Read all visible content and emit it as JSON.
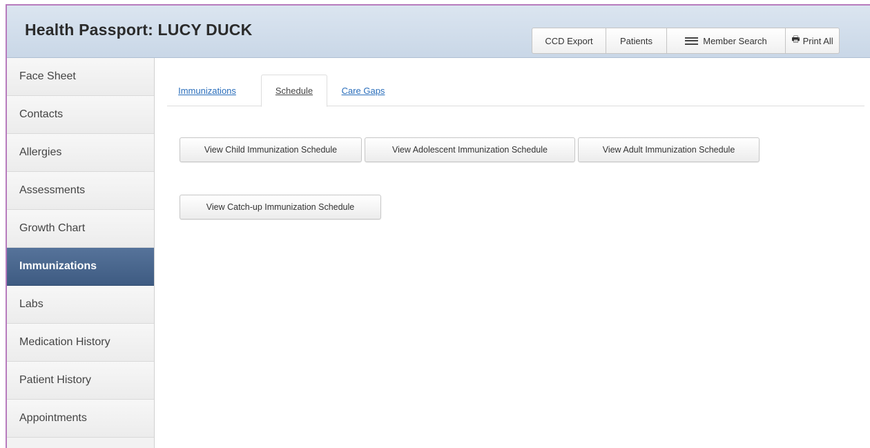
{
  "header": {
    "title": "Health Passport: LUCY DUCK",
    "buttons": {
      "ccd_export": "CCD Export",
      "patients": "Patients",
      "member_search": "Member Search",
      "print_all": "Print All"
    },
    "icons": {
      "member_search": "hamburger-icon",
      "print_all": "printer-icon"
    }
  },
  "sidebar": {
    "items": [
      {
        "label": "Face Sheet"
      },
      {
        "label": "Contacts"
      },
      {
        "label": "Allergies"
      },
      {
        "label": "Assessments"
      },
      {
        "label": "Growth Chart"
      },
      {
        "label": "Immunizations"
      },
      {
        "label": "Labs"
      },
      {
        "label": "Medication History"
      },
      {
        "label": "Patient History"
      },
      {
        "label": "Appointments"
      }
    ],
    "active": "Immunizations",
    "active_color": "#4a6790"
  },
  "main": {
    "tabs": [
      {
        "label": "Immunizations"
      },
      {
        "label": "Schedule"
      },
      {
        "label": "Care Gaps"
      }
    ],
    "active_tab": "Schedule",
    "schedule_buttons": [
      {
        "label": "View Child Immunization Schedule"
      },
      {
        "label": "View Adolescent Immunization Schedule"
      },
      {
        "label": "View Adult Immunization Schedule"
      },
      {
        "label": "View Catch-up Immunization Schedule"
      }
    ]
  },
  "colors": {
    "link": "#2a6ebb",
    "header_bg": "#d1dded",
    "frame_border": "#b77bbd"
  }
}
